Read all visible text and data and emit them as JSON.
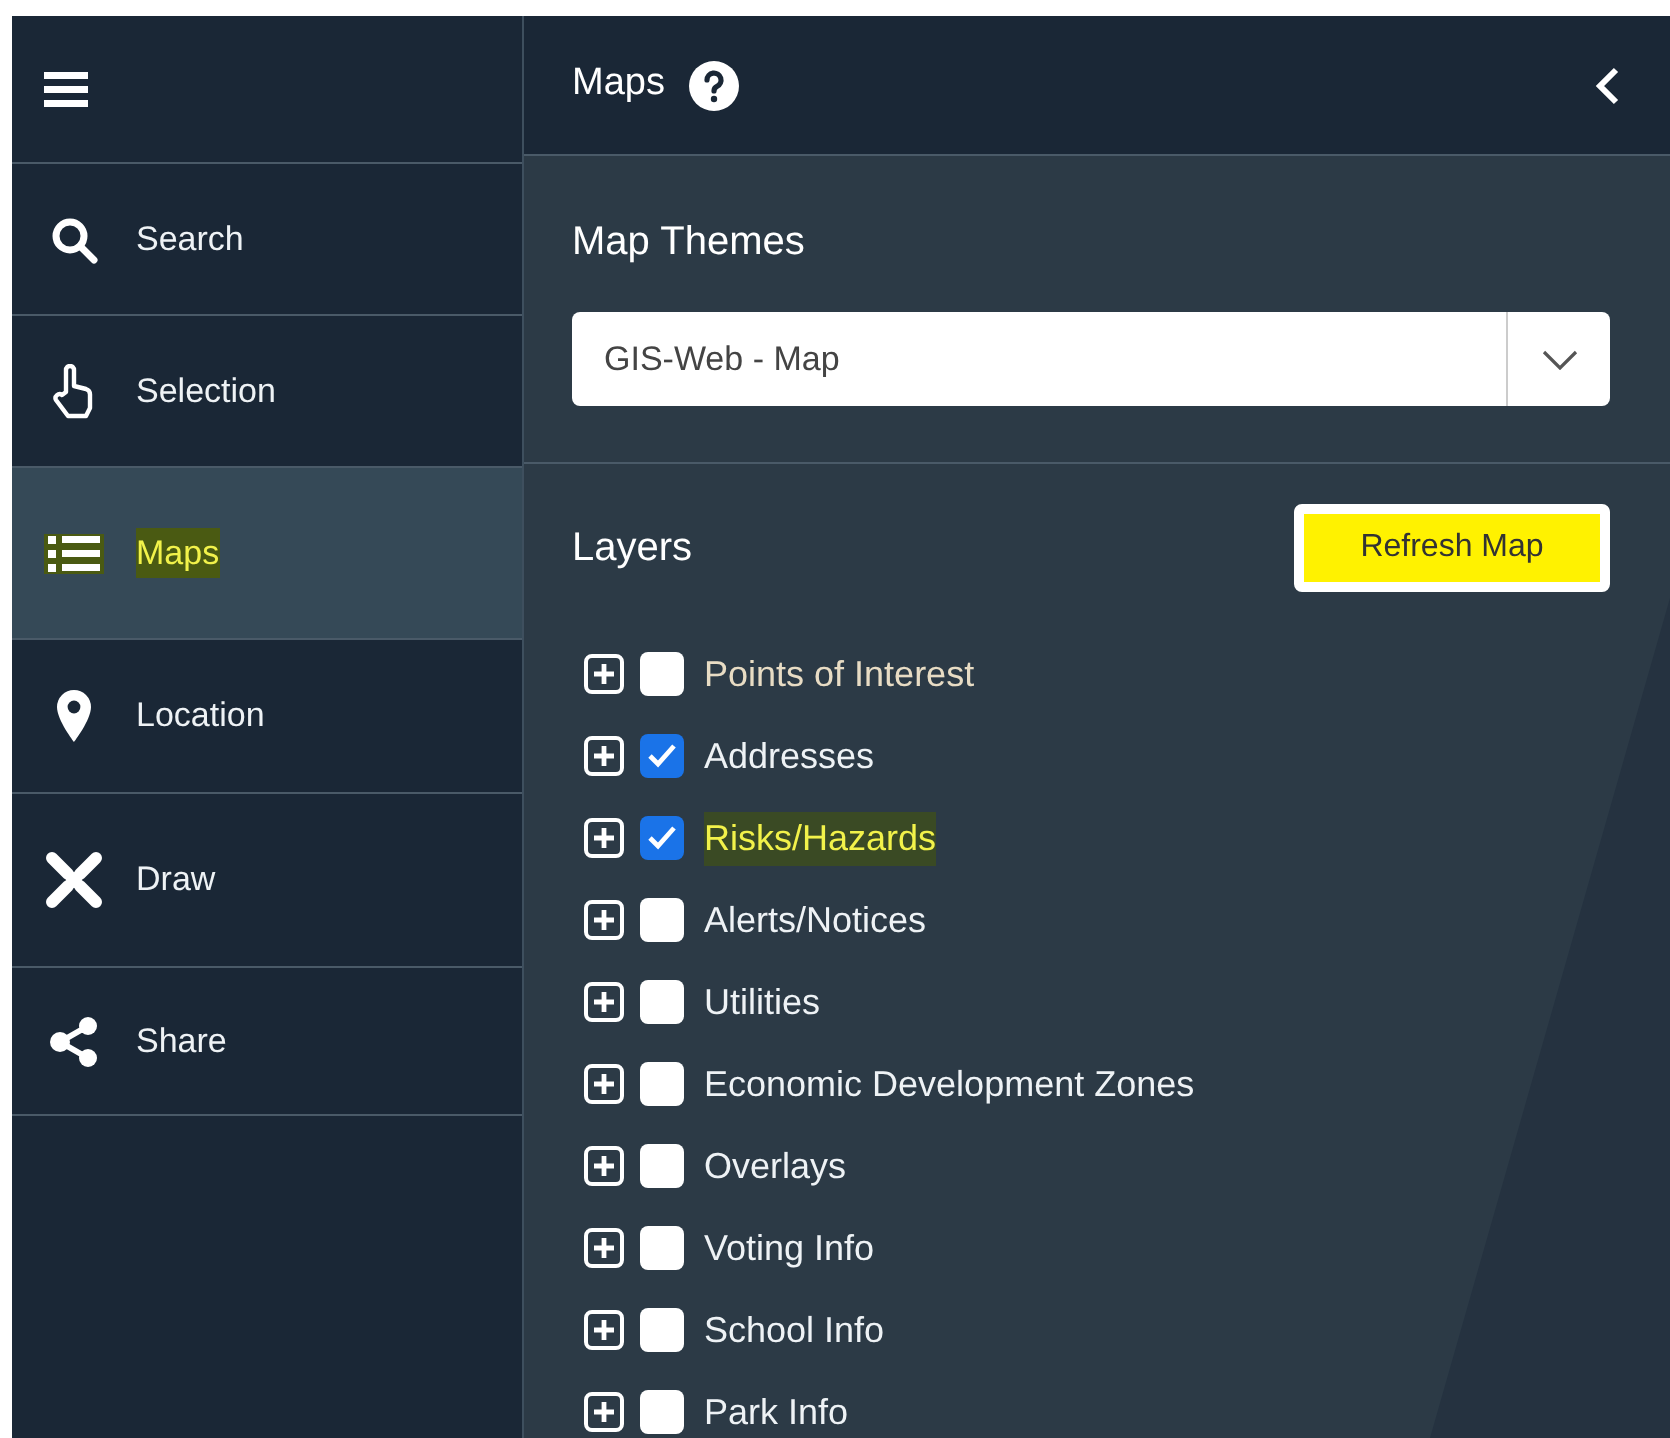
{
  "sidebar": {
    "items": [
      {
        "kind": "search",
        "label": "Search",
        "selected": false,
        "highlighted": false
      },
      {
        "kind": "selection",
        "label": "Selection",
        "selected": false,
        "highlighted": false
      },
      {
        "kind": "maps",
        "label": "Maps",
        "selected": true,
        "highlighted": true
      },
      {
        "kind": "location",
        "label": "Location",
        "selected": false,
        "highlighted": false
      },
      {
        "kind": "draw",
        "label": "Draw",
        "selected": false,
        "highlighted": false
      },
      {
        "kind": "share",
        "label": "Share",
        "selected": false,
        "highlighted": false
      }
    ]
  },
  "panel": {
    "title": "Maps",
    "map_themes": {
      "title": "Map Themes",
      "value": "GIS-Web - Map"
    },
    "layers": {
      "title": "Layers",
      "refresh_button": {
        "label": "Refresh Map",
        "highlighted": true
      },
      "items": [
        {
          "label": "Points of Interest",
          "checked": false,
          "hovered": true,
          "highlighted": false
        },
        {
          "label": "Addresses",
          "checked": true,
          "hovered": false,
          "highlighted": false
        },
        {
          "label": "Risks/Hazards",
          "checked": true,
          "hovered": false,
          "highlighted": true
        },
        {
          "label": "Alerts/Notices",
          "checked": false,
          "hovered": false,
          "highlighted": false
        },
        {
          "label": "Utilities",
          "checked": false,
          "hovered": false,
          "highlighted": false
        },
        {
          "label": "Economic Development Zones",
          "checked": false,
          "hovered": false,
          "highlighted": false
        },
        {
          "label": "Overlays",
          "checked": false,
          "hovered": false,
          "highlighted": false
        },
        {
          "label": "Voting Info",
          "checked": false,
          "hovered": false,
          "highlighted": false
        },
        {
          "label": "School Info",
          "checked": false,
          "hovered": false,
          "highlighted": false
        },
        {
          "label": "Park Info",
          "checked": false,
          "hovered": false,
          "highlighted": false
        }
      ]
    }
  }
}
